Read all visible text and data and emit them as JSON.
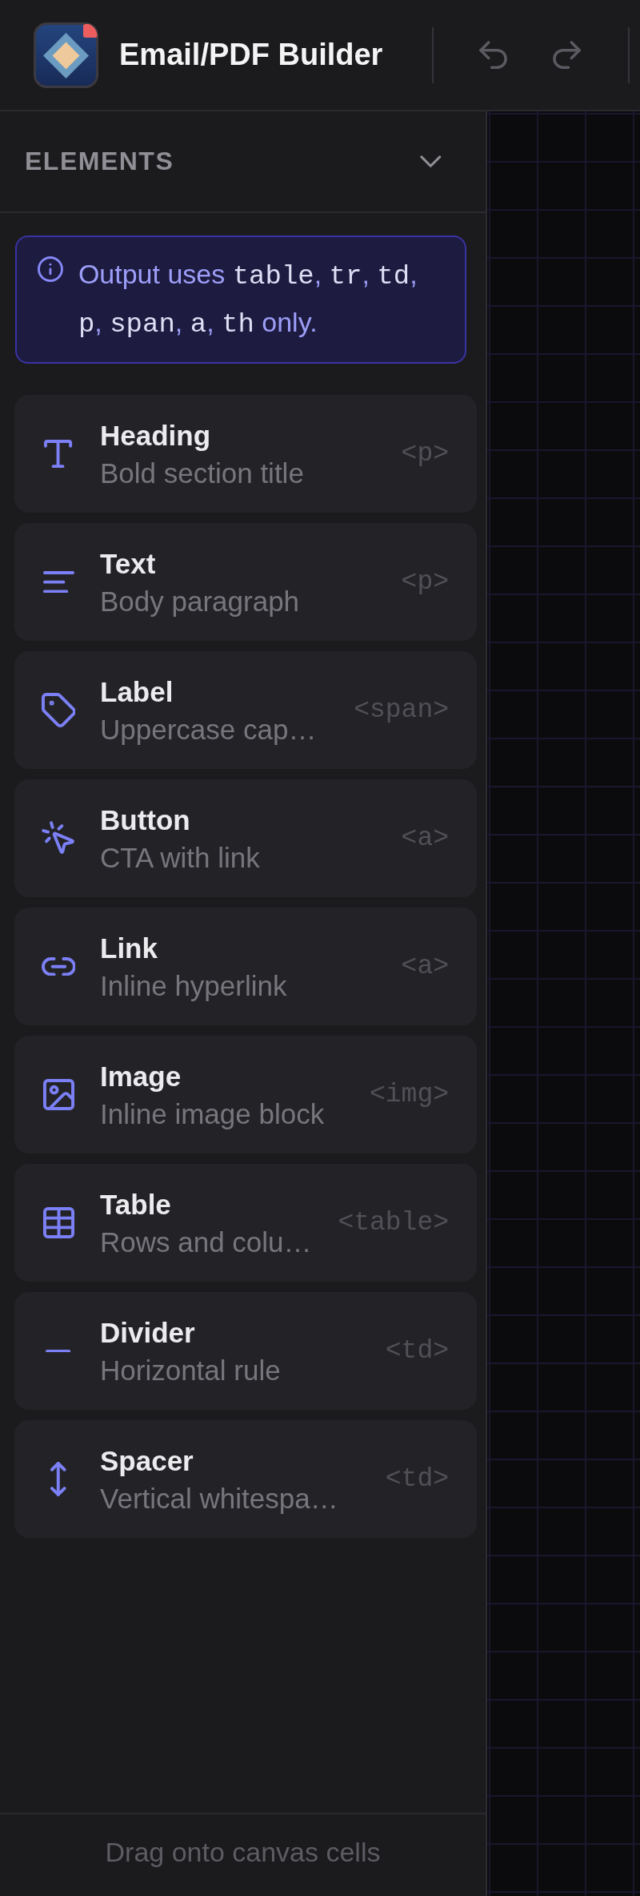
{
  "header": {
    "title": "Email/PDF Builder"
  },
  "section": {
    "title": "ELEMENTS",
    "expanded": true
  },
  "info": {
    "parts": [
      {
        "kind": "text",
        "text": "Output uses "
      },
      {
        "kind": "code",
        "text": "table"
      },
      {
        "kind": "text",
        "text": ", "
      },
      {
        "kind": "code",
        "text": "tr"
      },
      {
        "kind": "text",
        "text": ", "
      },
      {
        "kind": "code",
        "text": "td"
      },
      {
        "kind": "text",
        "text": ", "
      },
      {
        "kind": "code",
        "text": "p"
      },
      {
        "kind": "text",
        "text": ", "
      },
      {
        "kind": "code",
        "text": "span"
      },
      {
        "kind": "text",
        "text": ", "
      },
      {
        "kind": "code",
        "text": "a"
      },
      {
        "kind": "text",
        "text": ", "
      },
      {
        "kind": "code",
        "text": "th"
      },
      {
        "kind": "text",
        "text": " only."
      }
    ]
  },
  "elements": [
    {
      "kind": "heading",
      "name": "Heading",
      "description": "Bold section title",
      "tag": "<p>"
    },
    {
      "kind": "text",
      "name": "Text",
      "description": "Body paragraph",
      "tag": "<p>"
    },
    {
      "kind": "label",
      "name": "Label",
      "description": "Uppercase cap…",
      "tag": "<span>"
    },
    {
      "kind": "button",
      "name": "Button",
      "description": "CTA with link",
      "tag": "<a>"
    },
    {
      "kind": "link",
      "name": "Link",
      "description": "Inline hyperlink",
      "tag": "<a>"
    },
    {
      "kind": "image",
      "name": "Image",
      "description": "Inline image block",
      "tag": "<img>"
    },
    {
      "kind": "table",
      "name": "Table",
      "description": "Rows and colu…",
      "tag": "<table>"
    },
    {
      "kind": "divider",
      "name": "Divider",
      "description": "Horizontal rule",
      "tag": "<td>"
    },
    {
      "kind": "spacer",
      "name": "Spacer",
      "description": "Vertical whitespa…",
      "tag": "<td>"
    }
  ],
  "footer": {
    "hint": "Drag onto canvas cells"
  }
}
